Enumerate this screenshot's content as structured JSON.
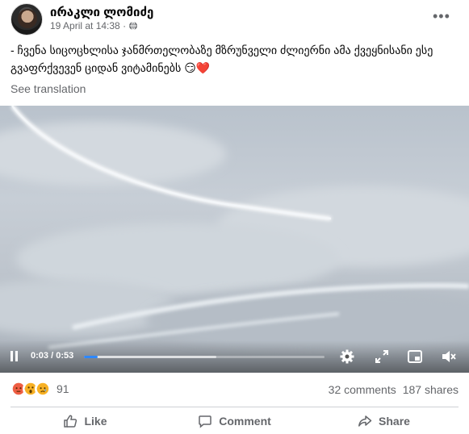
{
  "post": {
    "author": "ირაკლი ლომიძე",
    "timestamp": "19 April at 14:38 ·",
    "privacy_icon": "globe-icon",
    "more_label": "•••",
    "caption": "- ჩვენა სიცოცხლისა ჯანმრთელობაზე მზრუნველი ძლიერნი ამა ქვეყნისანი ესე გვაფრქვევენ ციდან ვიტამინებს 😏❤️",
    "see_translation": "See translation"
  },
  "video": {
    "current_time": "0:03",
    "separator": " / ",
    "duration": "0:53",
    "progress": 0.057,
    "buffered": 0.55,
    "icons": [
      "pause-icon",
      "settings-icon",
      "fullscreen-icon",
      "picture-in-picture-icon",
      "mute-icon"
    ]
  },
  "engagement": {
    "reaction_icons": [
      "angry-emoji-icon",
      "wow-emoji-icon",
      "sad-emoji-icon"
    ],
    "reaction_count": "91",
    "comments": "32 comments",
    "shares": "187 shares"
  },
  "actions": {
    "like": "Like",
    "comment": "Comment",
    "share": "Share"
  },
  "colors": {
    "accent": "#2d88ff",
    "secondary_text": "#65676b"
  }
}
